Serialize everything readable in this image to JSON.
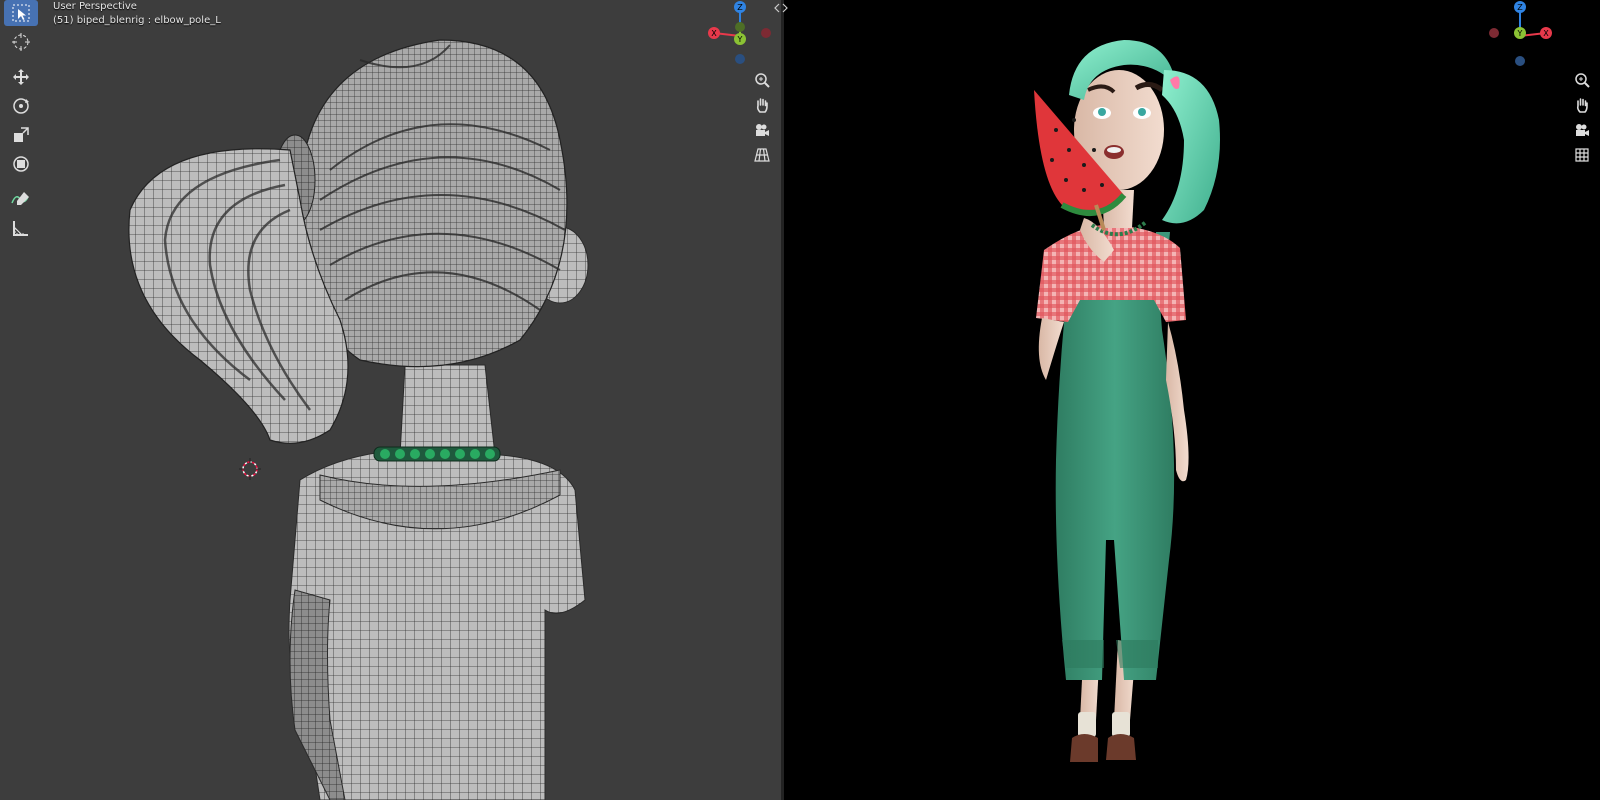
{
  "viewport_left": {
    "mode_label": "User Perspective",
    "object_label": "(51) biped_blenrig : elbow_pole_L",
    "background": "#3d3d3d"
  },
  "viewport_right": {
    "background": "#000000"
  },
  "gizmo": {
    "x_label": "X",
    "y_label": "Y",
    "z_label": "Z",
    "x_color": "#e8394b",
    "y_color": "#8bc234",
    "z_color": "#2f83e2"
  },
  "toolbar": {
    "tools": [
      "select-box-icon",
      "cursor-icon",
      "move-icon",
      "rotate-icon",
      "scale-icon",
      "transform-icon",
      "annotate-icon",
      "measure-icon"
    ],
    "active_color": "#4772b3"
  },
  "nav_buttons": [
    "zoom-icon",
    "pan-hand-icon",
    "camera-icon",
    "grid-icon"
  ],
  "scene": {
    "hair_color": "#6fd9b8",
    "shirt_color": "#e0555a",
    "overalls_color": "#3e9a7b",
    "watermelon_color": "#e0363a"
  }
}
